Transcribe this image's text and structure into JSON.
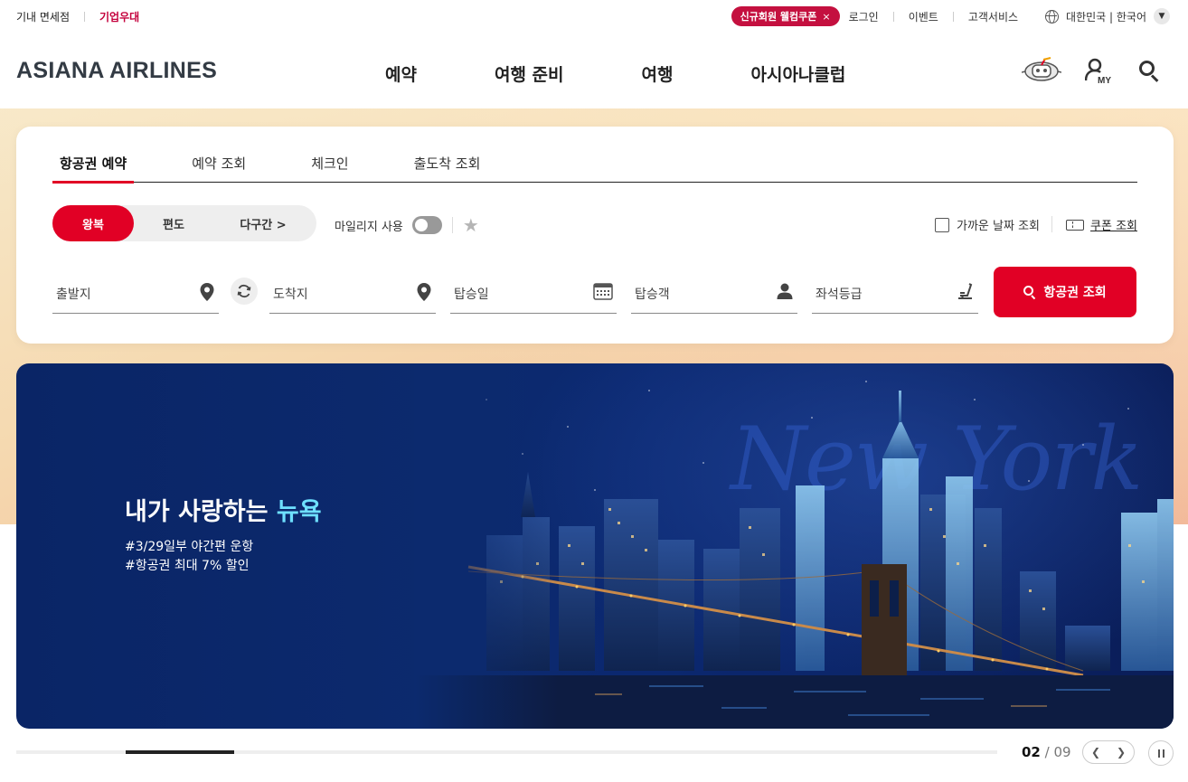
{
  "utility": {
    "duty_free": "기내 면세점",
    "corporate": "기업우대",
    "welcome_coupon": "신규회원 웰컴쿠폰",
    "coupon_close": "×",
    "login": "로그인",
    "event": "이벤트",
    "customer_service": "고객서비스",
    "language": "대한민국 | 한국어"
  },
  "header": {
    "logo": "ASIANA AIRLINES",
    "nav": [
      "예약",
      "여행 준비",
      "여행",
      "아시아나클럽"
    ],
    "my_label": "MY"
  },
  "booking": {
    "tabs": [
      "항공권 예약",
      "예약 조회",
      "체크인",
      "출도착 조회"
    ],
    "trip_types": [
      "왕복",
      "편도",
      "다구간 >"
    ],
    "mileage_label": "마일리지 사용",
    "nearby_dates_label": "가까운 날짜 조회",
    "coupon_lookup": "쿠폰 조회",
    "fields": {
      "origin": "출발지",
      "destination": "도착지",
      "date": "탑승일",
      "passengers": "탑승객",
      "cabin": "좌석등급"
    },
    "search_button": "항공권 조회"
  },
  "banner": {
    "title_prefix": "내가 사랑하는",
    "title_highlight": "뉴욕",
    "line1": "#3/29일부 야간편 운항",
    "line2": "#항공권 최대 7% 할인",
    "script_text": "New York"
  },
  "pager": {
    "current": "02",
    "separator": " / ",
    "total": "09",
    "progress_fraction": 0.111
  },
  "colors": {
    "brand_red": "#e10025",
    "coupon_pill": "#c4103f",
    "banner_navy": "#0c2a6e",
    "highlight_cyan": "#6ee0ff"
  }
}
